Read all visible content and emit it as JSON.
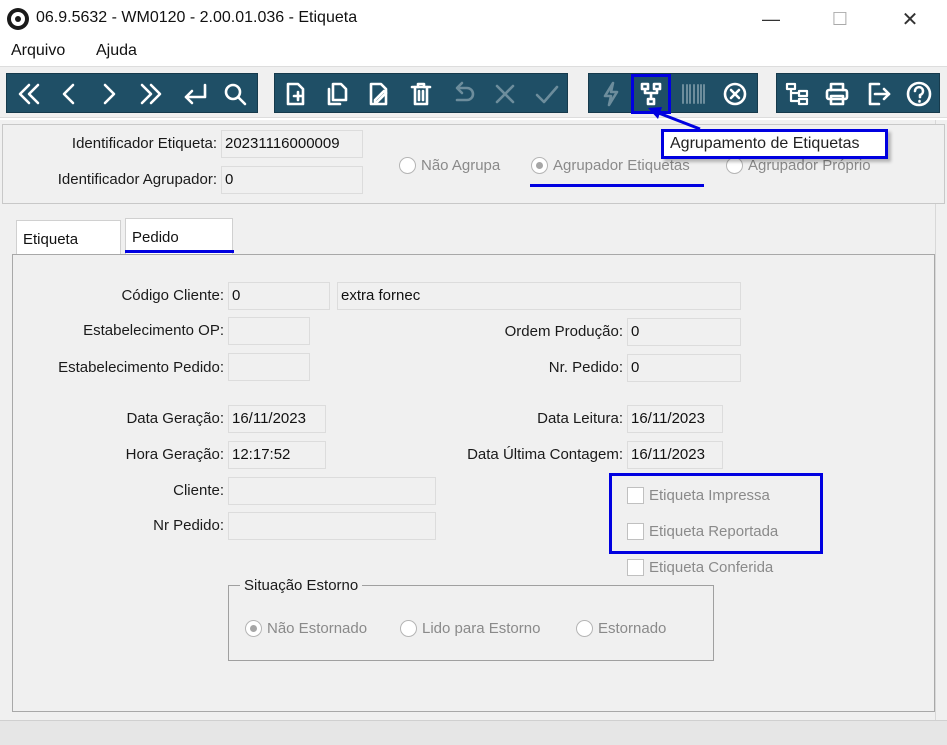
{
  "window": {
    "title": "06.9.5632 - WM0120 - 2.00.01.036 - Etiqueta",
    "minimize": "—",
    "maximize": "☐",
    "close": "✕"
  },
  "menu": [
    "Arquivo",
    "Ajuda"
  ],
  "toolbar": {
    "tooltip": "Agrupamento de Etiquetas",
    "highlight_color": "#0000e0",
    "group_color": "#1f4f66",
    "buttons": [
      "first-icon",
      "previous-icon",
      "next-icon",
      "last-icon",
      "goto-icon",
      "search-icon",
      "new-icon",
      "copy-icon",
      "edit-icon",
      "delete-icon",
      "undo-icon",
      "cancel-icon",
      "save-icon",
      "lightning-icon",
      "grouping-icon",
      "barcode-icon",
      "remove-icon",
      "tree-icon",
      "print-icon",
      "exit-icon",
      "help-icon"
    ]
  },
  "header": {
    "identificador_etiqueta_label": "Identificador Etiqueta:",
    "identificador_etiqueta_value": "20231116000009",
    "identificador_agrupador_label": "Identificador Agrupador:",
    "identificador_agrupador_value": "0",
    "radios": [
      {
        "label": "Não Agrupa",
        "selected": false
      },
      {
        "label": "Agrupador Etiquetas",
        "selected": true
      },
      {
        "label": "Agrupador Próprio",
        "selected": false
      }
    ]
  },
  "tabs": [
    {
      "label": "Etiqueta",
      "active": false
    },
    {
      "label": "Pedido",
      "active": true
    }
  ],
  "pedido": {
    "codigo_cliente_label": "Código Cliente:",
    "codigo_cliente_value": "0",
    "codigo_cliente_desc": "extra fornec",
    "estab_op_label": "Estabelecimento OP:",
    "estab_op_value": "",
    "ordem_producao_label": "Ordem Produção:",
    "ordem_producao_value": "0",
    "estab_pedido_label": "Estabelecimento Pedido:",
    "estab_pedido_value": "",
    "nr_pedido_label": "Nr. Pedido:",
    "nr_pedido_value": "0",
    "data_geracao_label": "Data Geração:",
    "data_geracao_value": "16/11/2023",
    "data_leitura_label": "Data Leitura:",
    "data_leitura_value": "16/11/2023",
    "hora_geracao_label": "Hora Geração:",
    "hora_geracao_value": "12:17:52",
    "data_ultima_contagem_label": "Data Última Contagem:",
    "data_ultima_contagem_value": "16/11/2023",
    "cliente_label": "Cliente:",
    "cliente_value": "",
    "nr_pedido2_label": "Nr Pedido:",
    "nr_pedido2_value": "",
    "checkboxes": [
      {
        "label": "Etiqueta Impressa",
        "checked": false
      },
      {
        "label": "Etiqueta Reportada",
        "checked": false
      },
      {
        "label": "Etiqueta Conferida",
        "checked": false
      }
    ],
    "situacao_estorno": {
      "title": "Situação Estorno",
      "options": [
        {
          "label": "Não Estornado",
          "selected": true
        },
        {
          "label": "Lido para Estorno",
          "selected": false
        },
        {
          "label": "Estornado",
          "selected": false
        }
      ]
    }
  }
}
